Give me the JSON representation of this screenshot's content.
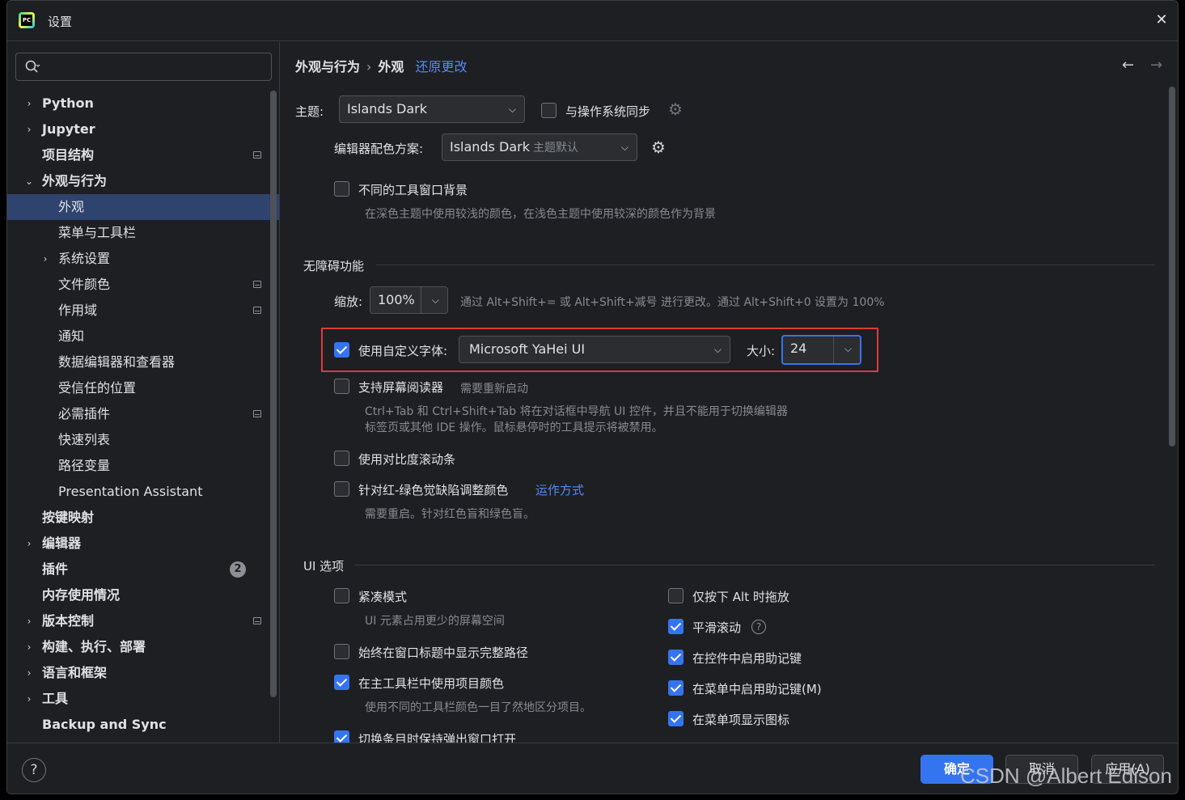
{
  "window": {
    "title": "设置",
    "close": "✕"
  },
  "search": {
    "placeholder": ""
  },
  "sidebar": {
    "items": [
      {
        "label": "Python",
        "level": 0,
        "chevron": "›",
        "mark": false
      },
      {
        "label": "Jupyter",
        "level": 0,
        "chevron": "›",
        "mark": false
      },
      {
        "label": "项目结构",
        "level": 0,
        "chevron": "",
        "mark": true
      },
      {
        "label": "外观与行为",
        "level": 0,
        "chevron": "⌄",
        "mark": false
      },
      {
        "label": "外观",
        "level": 1,
        "chevron": "",
        "mark": false,
        "selected": true
      },
      {
        "label": "菜单与工具栏",
        "level": 1,
        "chevron": "",
        "mark": false
      },
      {
        "label": "系统设置",
        "level": 1,
        "chevron": "›",
        "mark": false
      },
      {
        "label": "文件颜色",
        "level": 1,
        "chevron": "",
        "mark": true
      },
      {
        "label": "作用域",
        "level": 1,
        "chevron": "",
        "mark": true
      },
      {
        "label": "通知",
        "level": 1,
        "chevron": "",
        "mark": false
      },
      {
        "label": "数据编辑器和查看器",
        "level": 1,
        "chevron": "",
        "mark": false
      },
      {
        "label": "受信任的位置",
        "level": 1,
        "chevron": "",
        "mark": false
      },
      {
        "label": "必需插件",
        "level": 1,
        "chevron": "",
        "mark": true
      },
      {
        "label": "快速列表",
        "level": 1,
        "chevron": "",
        "mark": false
      },
      {
        "label": "路径变量",
        "level": 1,
        "chevron": "",
        "mark": false
      },
      {
        "label": "Presentation Assistant",
        "level": 1,
        "chevron": "",
        "mark": false
      },
      {
        "label": "按键映射",
        "level": 0,
        "chevron": "",
        "mark": false
      },
      {
        "label": "编辑器",
        "level": 0,
        "chevron": "›",
        "mark": false
      },
      {
        "label": "插件",
        "level": 0,
        "chevron": "",
        "mark": false,
        "badge": "2"
      },
      {
        "label": "内存使用情况",
        "level": 0,
        "chevron": "",
        "mark": false
      },
      {
        "label": "版本控制",
        "level": 0,
        "chevron": "›",
        "mark": true
      },
      {
        "label": "构建、执行、部署",
        "level": 0,
        "chevron": "›",
        "mark": false
      },
      {
        "label": "语言和框架",
        "level": 0,
        "chevron": "›",
        "mark": false
      },
      {
        "label": "工具",
        "level": 0,
        "chevron": "›",
        "mark": false
      },
      {
        "label": "Backup and Sync",
        "level": 0,
        "chevron": "",
        "mark": false
      }
    ]
  },
  "header": {
    "crumb1": "外观与行为",
    "sep": "›",
    "crumb2": "外观",
    "reset": "还原更改",
    "back": "←",
    "forward": "→"
  },
  "theme": {
    "label": "主题:",
    "value": "Islands Dark",
    "sync_label": "与操作系统同步"
  },
  "scheme": {
    "label": "编辑器配色方案:",
    "value": "Islands Dark",
    "sub": "主题默认"
  },
  "toolwin": {
    "label": "不同的工具窗口背景",
    "hint": "在深色主题中使用较浅的颜色，在浅色主题中使用较深的颜色作为背景"
  },
  "accessibility": {
    "title": "无障碍功能",
    "zoom_label": "缩放:",
    "zoom_value": "100%",
    "zoom_hint": "通过 Alt+Shift+= 或 Alt+Shift+减号 进行更改。通过 Alt+Shift+0 设置为 100%",
    "font_label": "使用自定义字体:",
    "font_value": "Microsoft YaHei UI",
    "size_label": "大小:",
    "size_value": "24",
    "reader_label": "支持屏幕阅读器",
    "reader_note": "需要重新启动",
    "reader_hint1": "Ctrl+Tab 和 Ctrl+Shift+Tab 将在对话框中导航 UI 控件，并且不能用于切换编辑器",
    "reader_hint2": "标签页或其他 IDE 操作。鼠标悬停时的工具提示将被禁用。",
    "contrast_label": "使用对比度滚动条",
    "color_label": "针对红-绿色觉缺陷调整颜色",
    "color_link": "运作方式",
    "color_hint": "需要重启。针对红色盲和绿色盲。"
  },
  "ui_options": {
    "title": "UI 选项",
    "compact_label": "紧凑模式",
    "compact_hint": "UI 元素占用更少的屏幕空间",
    "fullpath_label": "始终在窗口标题中显示完整路径",
    "projcolor_label": "在主工具栏中使用项目颜色",
    "projcolor_hint": "使用不同的工具栏颜色一目了然地区分项目。",
    "popup_label": "切换条目时保持弹出窗口打开",
    "alt_label": "仅按下 Alt 时拖放",
    "smooth_label": "平滑滚动",
    "mnemonic_ctrl_label": "在控件中启用助记键",
    "mnemonic_menu_label": "在菜单中启用助记键(M)",
    "menu_icons_label": "在菜单项显示图标"
  },
  "footer": {
    "help": "?",
    "ok": "确定",
    "cancel": "取消",
    "apply": "应用(A)"
  },
  "watermark": "CSDN @Albert Edison"
}
